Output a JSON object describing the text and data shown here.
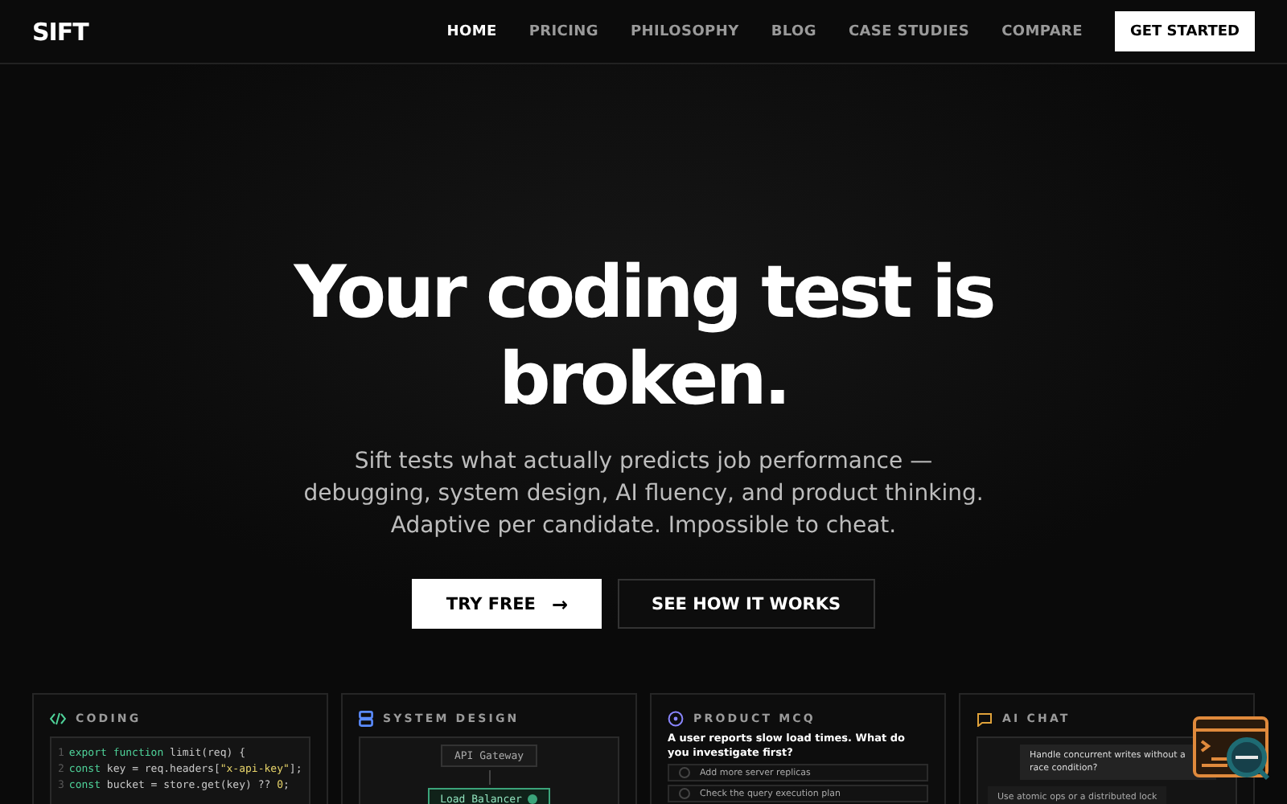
{
  "nav": {
    "logo": "SIFT",
    "links": [
      {
        "label": "HOME",
        "selected": true
      },
      {
        "label": "PRICING",
        "selected": false
      },
      {
        "label": "PHILOSOPHY",
        "selected": false
      },
      {
        "label": "BLOG",
        "selected": false
      },
      {
        "label": "CASE STUDIES",
        "selected": false
      },
      {
        "label": "COMPARE",
        "selected": false
      }
    ],
    "cta": "GET STARTED"
  },
  "hero": {
    "title": "Your coding test is broken.",
    "subtitle": "Sift tests what actually predicts job performance — debugging, system design, AI fluency, and product thinking. Adaptive per candidate. Impossible to cheat.",
    "buttons": [
      {
        "kind": "primary",
        "label": "TRY FREE",
        "arrow": "→"
      },
      {
        "kind": "secondary",
        "label": "SEE HOW IT WORKS"
      }
    ]
  },
  "cards": [
    {
      "kind": "coding",
      "title": "CODING",
      "lines": [
        {
          "number": "1",
          "segments": [
            {
              "kind": "keyword",
              "text": "export function"
            },
            {
              "kind": "plain",
              "text": " limit(req) {"
            }
          ]
        },
        {
          "number": "2",
          "segments": [
            {
              "kind": "keyword",
              "text": "const"
            },
            {
              "kind": "plain",
              "text": " key = req.headers["
            },
            {
              "kind": "string",
              "text": "\"x-api-key\""
            },
            {
              "kind": "plain",
              "text": "];"
            }
          ]
        },
        {
          "number": "3",
          "segments": [
            {
              "kind": "keyword",
              "text": "const"
            },
            {
              "kind": "plain",
              "text": " bucket = store.get(key) ?? "
            },
            {
              "kind": "string",
              "text": "0"
            },
            {
              "kind": "plain",
              "text": ";"
            }
          ]
        }
      ]
    },
    {
      "kind": "design",
      "title": "SYSTEM DESIGN",
      "nodes": [
        {
          "label": "API Gateway",
          "active": false
        },
        {
          "label": "Load Balancer",
          "active": true
        }
      ]
    },
    {
      "kind": "mcq",
      "title": "PRODUCT MCQ",
      "question": "A user reports slow load times. What do you investigate first?",
      "options": [
        {
          "text": "Add more server replicas",
          "selected": false
        },
        {
          "text": "Check the query execution plan",
          "selected": false
        }
      ]
    },
    {
      "kind": "chat",
      "title": "AI CHAT",
      "messages": [
        {
          "kind": "user",
          "text": "Handle concurrent writes without a race condition?"
        },
        {
          "kind": "reply",
          "text": "Use atomic ops or a distributed lock"
        }
      ]
    }
  ]
}
